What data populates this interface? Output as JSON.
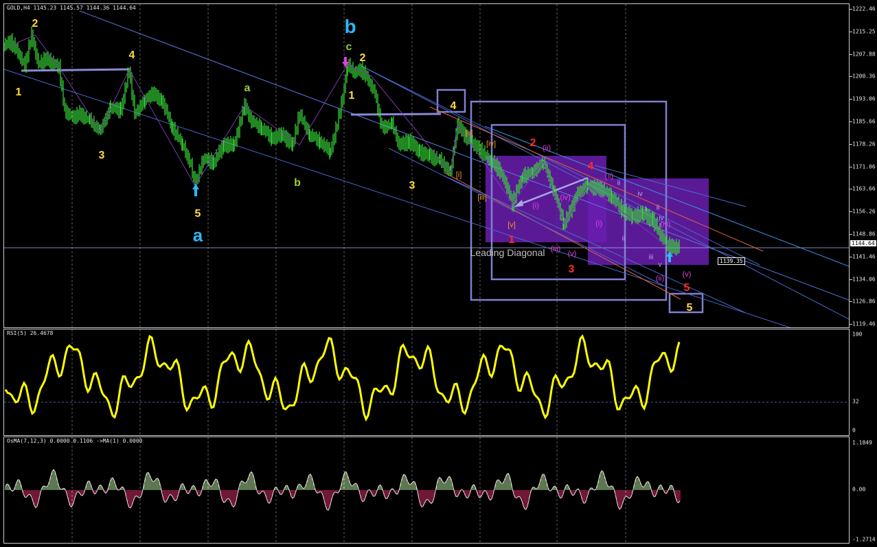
{
  "chart_title": "GOLD,H4  1145.23 1145.57 1144.36 1144.64",
  "current_price": "1144.64",
  "target_price": "1139.35",
  "price_axis": [
    "1222.46",
    "1215.25",
    "1207.88",
    "1200.36",
    "1193.06",
    "1185.66",
    "1178.26",
    "1171.06",
    "1163.66",
    "1156.26",
    "1148.86",
    "1141.46",
    "1134.06",
    "1126.86",
    "1119.46"
  ],
  "rsi": {
    "title": "RSI(5) 26.4678",
    "axis": [
      "100",
      "32",
      "0"
    ]
  },
  "osma": {
    "title": "OsMA(7,12,3) 0.0000 0.1106  ->MA(1) 0.0000",
    "axis": [
      "1.1849",
      "0.00",
      "-1.2714"
    ]
  },
  "annotation_text": "Leading Diagonal",
  "colors": {
    "price": "#39e03a",
    "rsi": "#ffff00",
    "osma_pos": "#b7f0a0",
    "osma_neg": "#e0306a",
    "wave_yellow": "#ffde3a",
    "wave_blue": "#2fb7f5",
    "wave_red": "#ff2a2a",
    "wave_magenta": "#e040e0",
    "wave_olive": "#9acd32",
    "purple_box": "#6a1fb0",
    "guide": "#8080d0"
  },
  "wave_labels": {
    "w_1a": "1",
    "w_2a": "2",
    "w_3a": "3",
    "w_4a": "4",
    "w_5a": "5",
    "w_a_big": "a",
    "w_a_small": "a",
    "w_b_small": "b",
    "w_b_big": "b",
    "w_c": "c",
    "w_1b": "1",
    "w_2b": "2",
    "w_3b": "3",
    "w_4b": "4",
    "w_r1": "1",
    "w_r2": "2",
    "w_r3": "3",
    "w_r4": "4",
    "w_r5": "5",
    "w_5box": "5",
    "w_ii_o": "[ii]",
    "w_iv_o": "[iv]",
    "w_i_o": "[i]",
    "w_iii_o": "[iii]",
    "w_v_o": "[v]",
    "w_ii_m": "(ii)",
    "w_i_m": "(i)",
    "w_iii_m": "(iii)",
    "w_v_m": "(v)",
    "w_iv_m": "(iv)",
    "w_ii_m2": "(ii)",
    "w_i_m2": "(i)",
    "w_ii_m3": "(ii)",
    "w_v_m2": "(v)",
    "w_iv_m2": "(iv)",
    "w_iv_s": "iv",
    "w_ii_s": "ii",
    "w_i_s": "i",
    "w_iii_s": "iii",
    "w_v_s": "v",
    "w_ii_s2": "ii",
    "w_iv_s2": "iv",
    "w_ii_s3": "ii"
  }
}
